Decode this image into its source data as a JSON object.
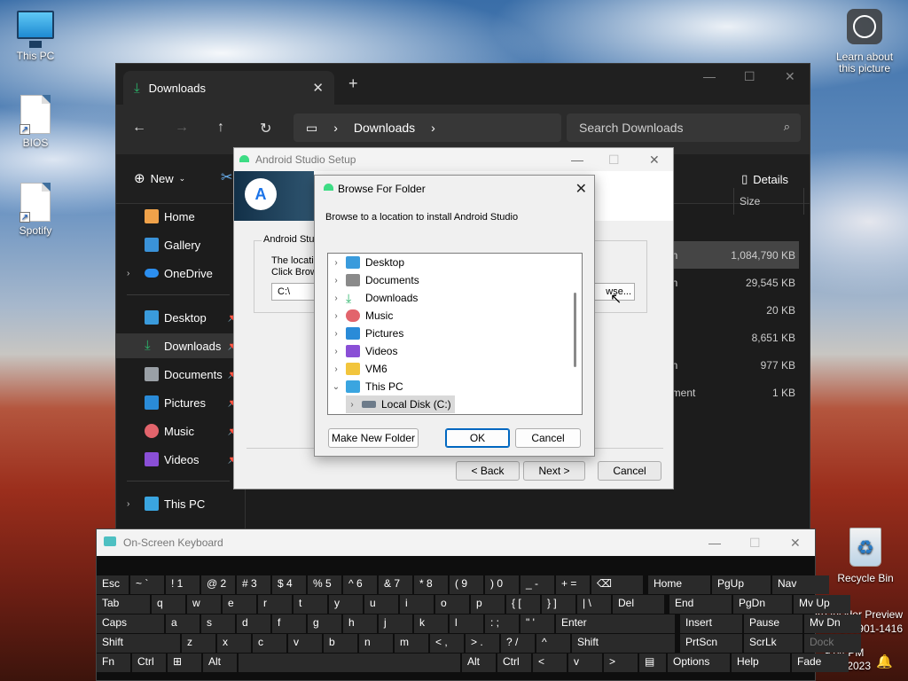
{
  "desktop": {
    "icons": [
      {
        "label": "This PC"
      },
      {
        "label": "BIOS"
      },
      {
        "label": "Spotify"
      },
      {
        "label": "Recycle Bin"
      }
    ],
    "learn_label_1": "Learn about",
    "learn_label_2": "this picture",
    "watermark_1": "Pro Insider Preview",
    "watermark_2": "elease.230901-1416"
  },
  "taskbar": {
    "time": "9:04 PM",
    "date": "12/23/2023"
  },
  "explorer": {
    "tab_title": "Downloads",
    "address": "Downloads",
    "search_placeholder": "Search Downloads",
    "new_label": "New",
    "details_label": "Details",
    "size_header": "Size",
    "sidebar": [
      {
        "label": "Home"
      },
      {
        "label": "Gallery"
      },
      {
        "label": "OneDrive"
      },
      {
        "label": "Desktop"
      },
      {
        "label": "Downloads"
      },
      {
        "label": "Documents"
      },
      {
        "label": "Pictures"
      },
      {
        "label": "Music"
      },
      {
        "label": "Videos"
      },
      {
        "label": "This PC"
      }
    ],
    "rows": [
      {
        "type": "on",
        "size": "1,084,790 KB"
      },
      {
        "type": "on",
        "size": "29,545 KB"
      },
      {
        "type": "e",
        "size": "20 KB"
      },
      {
        "type": "e",
        "size": "8,651 KB"
      },
      {
        "type": "on",
        "size": "977 KB"
      },
      {
        "type": "ument",
        "size": "1 KB"
      }
    ]
  },
  "setup": {
    "title": "Android Studio Setup",
    "group_label": "Android Studi",
    "text_line1": "The locati",
    "text_line2": "Click Brow",
    "path_value": "C:\\",
    "browse_stub": "wse...",
    "back_label": "< Back",
    "next_label": "Next >",
    "cancel_label": "Cancel"
  },
  "browse_dialog": {
    "title": "Browse For Folder",
    "message": "Browse to a location to install Android Studio",
    "tree": [
      {
        "label": "Desktop",
        "color": "#3a9bdc"
      },
      {
        "label": "Documents",
        "color": "#8a8a8a"
      },
      {
        "label": "Downloads",
        "color": "#2bb56b"
      },
      {
        "label": "Music",
        "color": "#e2646c"
      },
      {
        "label": "Pictures",
        "color": "#2a8bd8"
      },
      {
        "label": "Videos",
        "color": "#8a4fd6"
      },
      {
        "label": "VM6",
        "color": "#f2c53d"
      },
      {
        "label": "This PC",
        "color": "#3aa5e0"
      },
      {
        "label": "Local Disk (C:)",
        "color": "#6d7b8a"
      }
    ],
    "make_new_folder": "Make New Folder",
    "ok": "OK",
    "cancel": "Cancel"
  },
  "osk": {
    "title": "On-Screen Keyboard",
    "rows": [
      [
        "Esc",
        "~ `",
        "! 1",
        "@ 2",
        "# 3",
        "$ 4",
        "% 5",
        "^ 6",
        "& 7",
        "* 8",
        "( 9",
        ") 0",
        "_ -",
        "+ =",
        "⌫",
        "Home",
        "PgUp",
        "Nav"
      ],
      [
        "Tab",
        "q",
        "w",
        "e",
        "r",
        "t",
        "y",
        "u",
        "i",
        "o",
        "p",
        "{ [",
        "} ]",
        "| \\",
        "Del",
        "End",
        "PgDn",
        "Mv Up"
      ],
      [
        "Caps",
        "a",
        "s",
        "d",
        "f",
        "g",
        "h",
        "j",
        "k",
        "l",
        ": ;",
        "\" '",
        "Enter",
        "Insert",
        "Pause",
        "Mv Dn"
      ],
      [
        "Shift",
        "z",
        "x",
        "c",
        "v",
        "b",
        "n",
        "m",
        "< ,",
        "> .",
        "? /",
        "^",
        "Shift",
        "PrtScn",
        "ScrLk",
        "Dock"
      ],
      [
        "Fn",
        "Ctrl",
        "⊞",
        "Alt",
        "",
        "Alt",
        "Ctrl",
        "<",
        "v",
        ">",
        "▤",
        "Options",
        "Help",
        "Fade"
      ]
    ]
  }
}
